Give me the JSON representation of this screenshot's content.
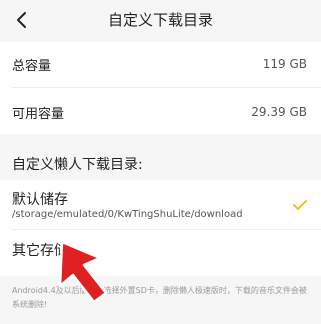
{
  "header": {
    "title": "自定义下载目录",
    "back_icon": "back-chevron-icon"
  },
  "storage": {
    "total_label": "总容量",
    "total_value": "119 GB",
    "available_label": "可用容量",
    "available_value": "29.39 GB"
  },
  "section": {
    "title": "自定义懒人下载目录:"
  },
  "options": [
    {
      "label": "默认储存",
      "path": "/storage/emulated/0/KwTingShuLite/download",
      "selected": true
    },
    {
      "label": "其它存储",
      "selected": false
    }
  ],
  "footnote": "Android4.4及以后版本，选择外置SD卡，删除懒人极速版时，下载的音乐文件会被系统删除!",
  "colors": {
    "accent": "#f5b800",
    "arrow": "#e02020"
  }
}
